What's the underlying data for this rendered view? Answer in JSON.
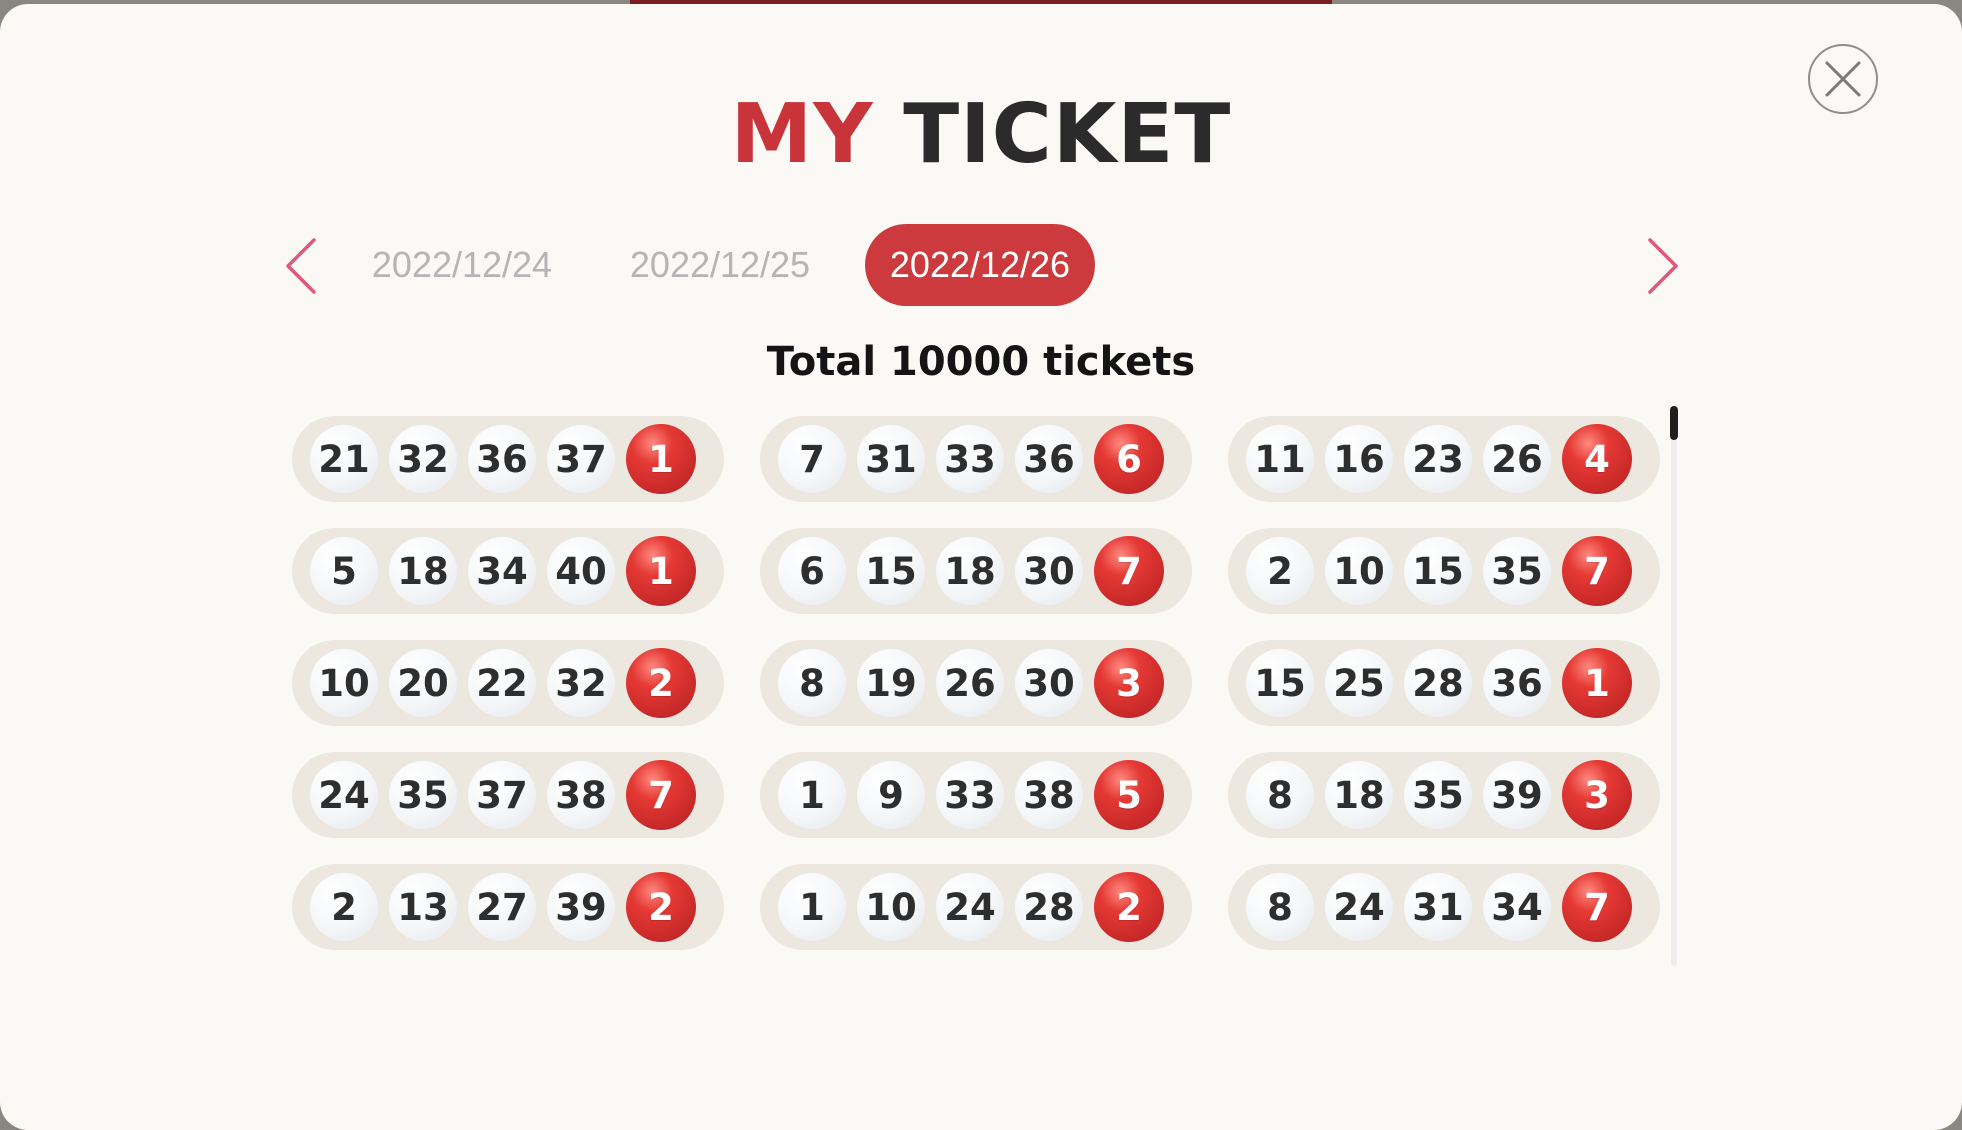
{
  "title": {
    "part1": "MY",
    "part2": "TICKET"
  },
  "close": {
    "icon": "close-icon"
  },
  "nav": {
    "prev_icon": "chevron-left-icon",
    "next_icon": "chevron-right-icon"
  },
  "dates": [
    "2022/12/24",
    "2022/12/25",
    "2022/12/26"
  ],
  "selected_date": "2022/12/26",
  "total_text": "Total 10000 tickets",
  "colors": {
    "accent": "#cc3a3d",
    "text_dark": "#2b2b2b",
    "inactive_date": "#b5b5b5"
  },
  "tickets": [
    {
      "numbers": [
        "21",
        "32",
        "36",
        "37"
      ],
      "bonus": "1"
    },
    {
      "numbers": [
        "7",
        "31",
        "33",
        "36"
      ],
      "bonus": "6"
    },
    {
      "numbers": [
        "11",
        "16",
        "23",
        "26"
      ],
      "bonus": "4"
    },
    {
      "numbers": [
        "5",
        "18",
        "34",
        "40"
      ],
      "bonus": "1"
    },
    {
      "numbers": [
        "6",
        "15",
        "18",
        "30"
      ],
      "bonus": "7"
    },
    {
      "numbers": [
        "2",
        "10",
        "15",
        "35"
      ],
      "bonus": "7"
    },
    {
      "numbers": [
        "10",
        "20",
        "22",
        "32"
      ],
      "bonus": "2"
    },
    {
      "numbers": [
        "8",
        "19",
        "26",
        "30"
      ],
      "bonus": "3"
    },
    {
      "numbers": [
        "15",
        "25",
        "28",
        "36"
      ],
      "bonus": "1"
    },
    {
      "numbers": [
        "24",
        "35",
        "37",
        "38"
      ],
      "bonus": "7"
    },
    {
      "numbers": [
        "1",
        "9",
        "33",
        "38"
      ],
      "bonus": "5"
    },
    {
      "numbers": [
        "8",
        "18",
        "35",
        "39"
      ],
      "bonus": "3"
    },
    {
      "numbers": [
        "2",
        "13",
        "27",
        "39"
      ],
      "bonus": "2"
    },
    {
      "numbers": [
        "1",
        "10",
        "24",
        "28"
      ],
      "bonus": "2"
    },
    {
      "numbers": [
        "8",
        "24",
        "31",
        "34"
      ],
      "bonus": "7"
    }
  ]
}
